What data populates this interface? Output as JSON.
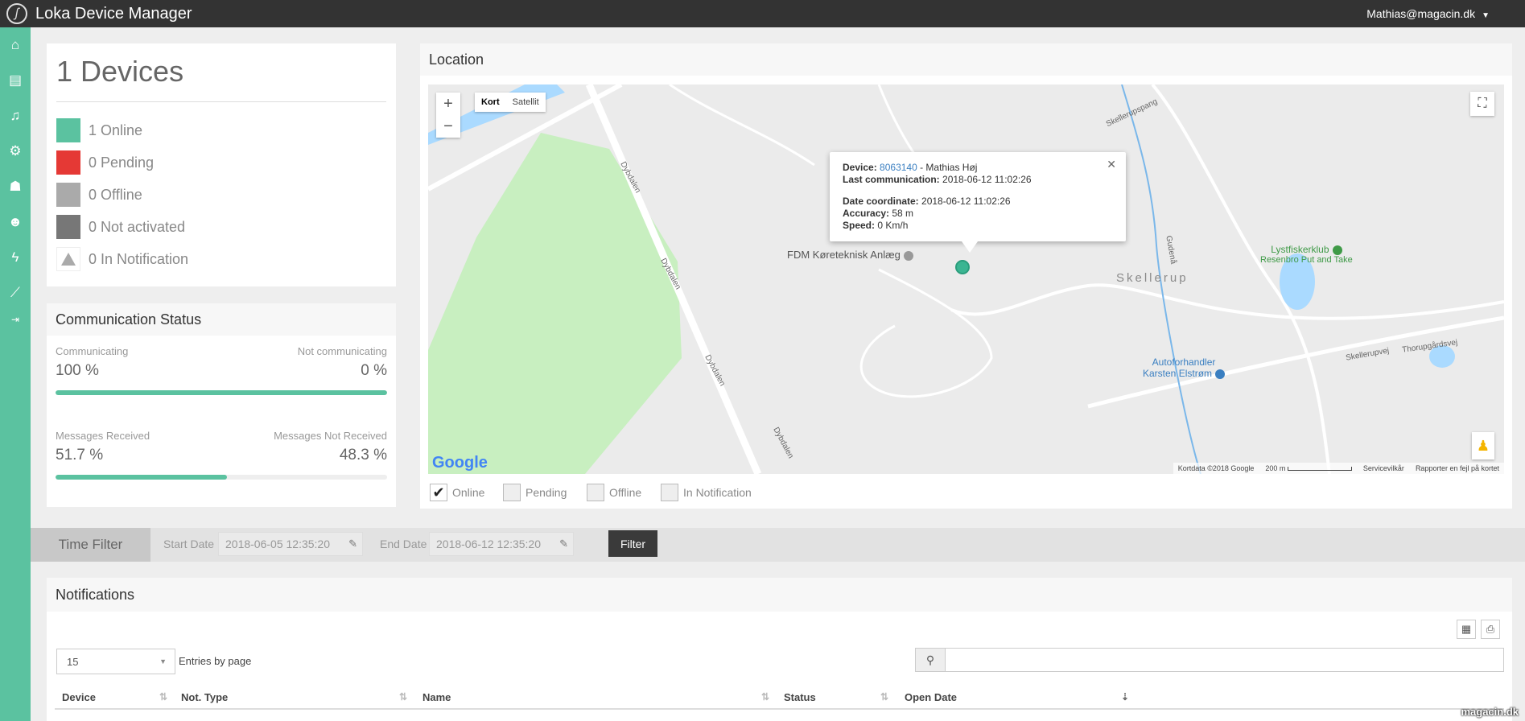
{
  "app": {
    "title": "Loka Device Manager",
    "user": "Mathias@magacin.dk"
  },
  "sidebar": {
    "icons": [
      "home-icon",
      "chip-icon",
      "bell-icon",
      "cogs-icon",
      "users-icon",
      "user-secret-icon",
      "bolt-icon",
      "line-chart-icon",
      "sign-in-icon"
    ]
  },
  "devices": {
    "title": "1 Devices",
    "legend": [
      {
        "label": "1 Online",
        "color": "#5bc2a0"
      },
      {
        "label": "0 Pending",
        "color": "#e53935"
      },
      {
        "label": "0 Offline",
        "color": "#aaaaaa"
      },
      {
        "label": "0 Not activated",
        "color": "#777777"
      },
      {
        "label": "0 In Notification",
        "color": "#aaaaaa"
      }
    ]
  },
  "comm": {
    "title": "Communication Status",
    "communicating_label": "Communicating",
    "communicating_value": "100 %",
    "not_communicating_label": "Not communicating",
    "not_communicating_value": "0 %",
    "communicating_fraction": 1.0,
    "received_label": "Messages Received",
    "received_value": "51.7 %",
    "not_received_label": "Messages Not Received",
    "not_received_value": "48.3 %",
    "received_fraction": 0.517
  },
  "location": {
    "title": "Location",
    "zoom_in": "+",
    "zoom_out": "−",
    "map_type_active": "Kort",
    "map_type_other": "Satellit",
    "popup": {
      "device_label": "Device:",
      "device_id": "8063140",
      "device_owner": " - Mathias Høj",
      "last_comm_label": "Last communication:",
      "last_comm_value": " 2018-06-12 11:02:26",
      "date_coord_label": "Date coordinate:",
      "date_coord_value": " 2018-06-12 11:02:26",
      "accuracy_label": "Accuracy:",
      "accuracy_value": " 58 m",
      "speed_label": "Speed:",
      "speed_value": " 0 Km/h"
    },
    "poi": {
      "fdm": "FDM Køreteknisk Anlæg",
      "lystfisker1": "Lystfiskerklub",
      "lystfisker2": "Resenbro Put and Take",
      "auto1": "Autoforhandler",
      "auto2": "Karsten Elstrøm",
      "town": "Skellerup"
    },
    "roads": {
      "dybdalen": "Dybdalen",
      "skellerupvej": "Skellerupvej",
      "thorupgaardsvej": "Thorupgårdsvej",
      "gudenaa": "Gudenå",
      "skellerupspang": "Skellerupspang"
    },
    "google": "Google",
    "footer": {
      "mapdata": "Kortdata ©2018 Google",
      "scale": "200 m",
      "terms": "Servicevilkår",
      "report": "Rapporter en fejl på kortet"
    },
    "filters": [
      {
        "label": "Online",
        "checked": true
      },
      {
        "label": "Pending",
        "checked": false
      },
      {
        "label": "Offline",
        "checked": false
      },
      {
        "label": "In Notification",
        "checked": false
      }
    ]
  },
  "time_filter": {
    "label": "Time Filter",
    "start_label": "Start Date",
    "start_value": "2018-06-05 12:35:20",
    "end_label": "End Date",
    "end_value": "2018-06-12 12:35:20",
    "button": "Filter"
  },
  "notifications": {
    "title": "Notifications",
    "page_size": "15",
    "entries_label": "Entries by page",
    "search_value": "",
    "columns": [
      "Device",
      "Not. Type",
      "Name",
      "Status",
      "Open Date"
    ]
  },
  "watermark": "magacin.dk"
}
